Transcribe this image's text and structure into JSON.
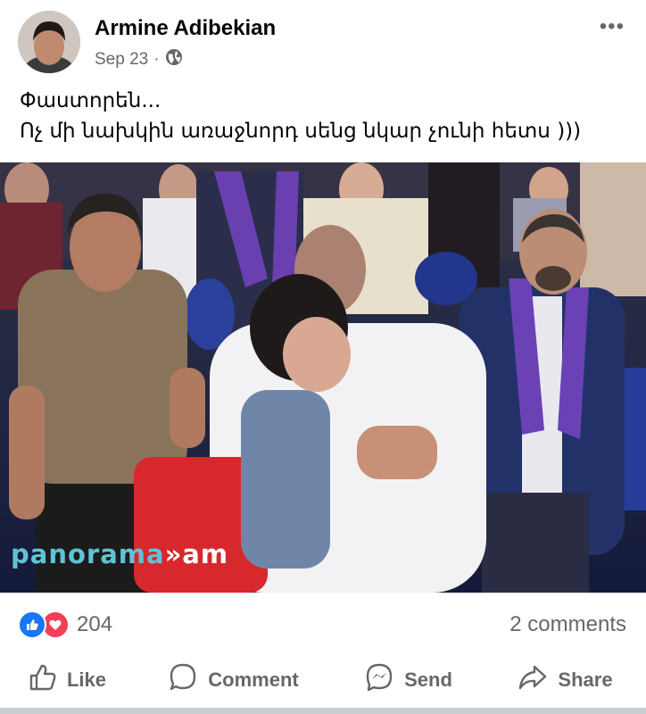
{
  "post": {
    "author": "Armine Adibekian",
    "date": "Sep 23",
    "separator": "·",
    "privacy_icon": "globe-icon",
    "more_label": "•••",
    "text_line1": "Փաստորեն...",
    "text_line2": "Ոչ մի նախկին առաջնորդ սենց նկար չունի հետս )))"
  },
  "photo": {
    "watermark_brand": "panorama",
    "watermark_sep": "»",
    "watermark_tld": "am"
  },
  "stats": {
    "reaction_icons": [
      "like-reaction-icon",
      "love-reaction-icon"
    ],
    "reaction_count": "204",
    "comments": "2 comments"
  },
  "actions": {
    "like": "Like",
    "comment": "Comment",
    "send": "Send",
    "share": "Share"
  },
  "colors": {
    "brand_blue": "#1877f2",
    "love_red": "#f33e58",
    "secondary_text": "#65676b",
    "watermark": "#5fc3d6"
  }
}
